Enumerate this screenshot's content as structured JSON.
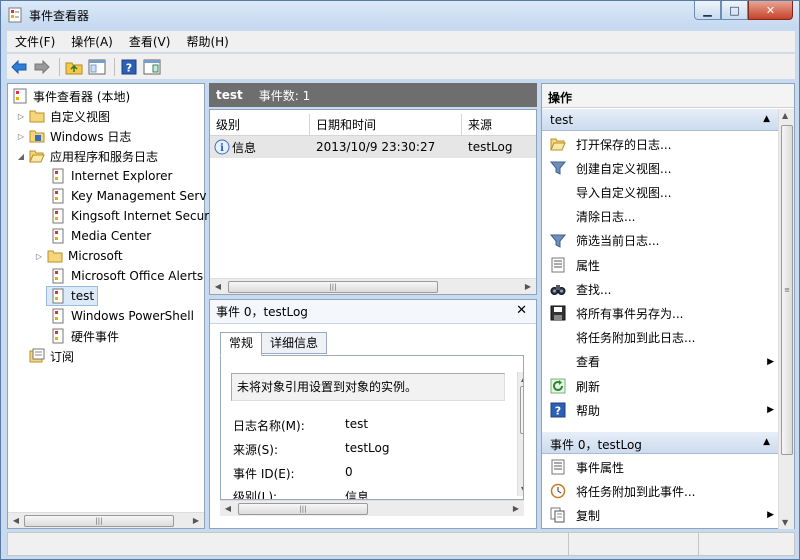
{
  "window": {
    "title": "事件查看器",
    "min": "▁",
    "max": "□",
    "close": "✕"
  },
  "menu": [
    "文件(F)",
    "操作(A)",
    "查看(V)",
    "帮助(H)"
  ],
  "tree": {
    "items": [
      {
        "label": "事件查看器 (本地)",
        "expander": ""
      },
      {
        "label": "自定义视图",
        "expander": "▷"
      },
      {
        "label": "Windows 日志",
        "expander": "▷"
      },
      {
        "label": "应用程序和服务日志",
        "expander": "◢"
      },
      {
        "label": "Internet Explorer",
        "expander": ""
      },
      {
        "label": "Key Management Serv",
        "expander": ""
      },
      {
        "label": "Kingsoft Internet Secur",
        "expander": ""
      },
      {
        "label": "Media Center",
        "expander": ""
      },
      {
        "label": "Microsoft",
        "expander": "▷"
      },
      {
        "label": "Microsoft Office Alerts",
        "expander": ""
      },
      {
        "label": "test",
        "expander": ""
      },
      {
        "label": "Windows PowerShell",
        "expander": ""
      },
      {
        "label": "硬件事件",
        "expander": ""
      },
      {
        "label": "订阅",
        "expander": ""
      }
    ]
  },
  "log_header": {
    "name": "test",
    "count": "事件数: 1"
  },
  "list": {
    "columns": [
      "级别",
      "日期和时间",
      "来源"
    ],
    "rows": [
      {
        "level": "信息",
        "datetime": "2013/10/9 23:30:27",
        "source": "testLog"
      }
    ]
  },
  "detail": {
    "title": "事件 0，testLog",
    "close": "✕",
    "tabs": [
      "常规",
      "详细信息"
    ],
    "message": "未将对象引用设置到对象的实例。",
    "fields": [
      {
        "key": "日志名称(M):",
        "value": "test"
      },
      {
        "key": "来源(S):",
        "value": "testLog"
      },
      {
        "key": "事件 ID(E):",
        "value": "0"
      },
      {
        "key": "级别(L):",
        "value": "信息"
      }
    ]
  },
  "actions": {
    "title": "操作",
    "section1": "test",
    "items1": [
      {
        "label": "打开保存的日志...",
        "icon": "folder-open-icon",
        "submenu": ""
      },
      {
        "label": "创建自定义视图...",
        "icon": "filter-icon",
        "submenu": ""
      },
      {
        "label": "导入自定义视图...",
        "icon": "",
        "submenu": ""
      },
      {
        "label": "清除日志...",
        "icon": "",
        "submenu": ""
      },
      {
        "label": "筛选当前日志...",
        "icon": "filter-icon",
        "submenu": ""
      },
      {
        "label": "属性",
        "icon": "properties-icon",
        "submenu": ""
      },
      {
        "label": "查找...",
        "icon": "binoculars-icon",
        "submenu": ""
      },
      {
        "label": "将所有事件另存为...",
        "icon": "save-icon",
        "submenu": ""
      },
      {
        "label": "将任务附加到此日志...",
        "icon": "",
        "submenu": ""
      },
      {
        "label": "查看",
        "icon": "",
        "submenu": "▶"
      },
      {
        "label": "刷新",
        "icon": "refresh-icon",
        "submenu": ""
      },
      {
        "label": "帮助",
        "icon": "help-icon",
        "submenu": "▶"
      }
    ],
    "section2": "事件 0，testLog",
    "items2": [
      {
        "label": "事件属性",
        "icon": "properties-icon",
        "submenu": ""
      },
      {
        "label": "将任务附加到此事件...",
        "icon": "task-icon",
        "submenu": ""
      },
      {
        "label": "复制",
        "icon": "copy-icon",
        "submenu": "▶"
      }
    ]
  },
  "colors": {
    "selection": "#dbe9f9",
    "header_dark": "#6e6e6e",
    "section": "#cbdbee"
  }
}
